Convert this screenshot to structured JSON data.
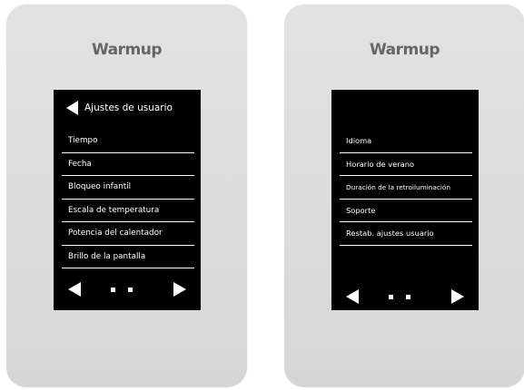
{
  "devices": [
    {
      "brand": "Warmup",
      "title": "Ajustes de usuario",
      "menu": [
        "Tiempo",
        "Fecha",
        "Bloqueo infantil",
        "Escala de temperatura",
        "Potencia del calentador",
        "Brillo de la pantalla"
      ]
    },
    {
      "brand": "Warmup",
      "menu": [
        "Idioma",
        "Horario de verano",
        "Duración de la retroiluminación",
        "Soporte",
        "Restab. ajustes usuario"
      ]
    }
  ],
  "colors": {
    "device_body": "#dcdcdc",
    "screen": "#000000",
    "screen_text": "#ffffff",
    "brand_text": "#666666"
  },
  "icons": {
    "back": "back-arrow-icon",
    "prev": "prev-page-icon",
    "next": "next-page-icon",
    "page_dot": "page-dot-icon"
  }
}
